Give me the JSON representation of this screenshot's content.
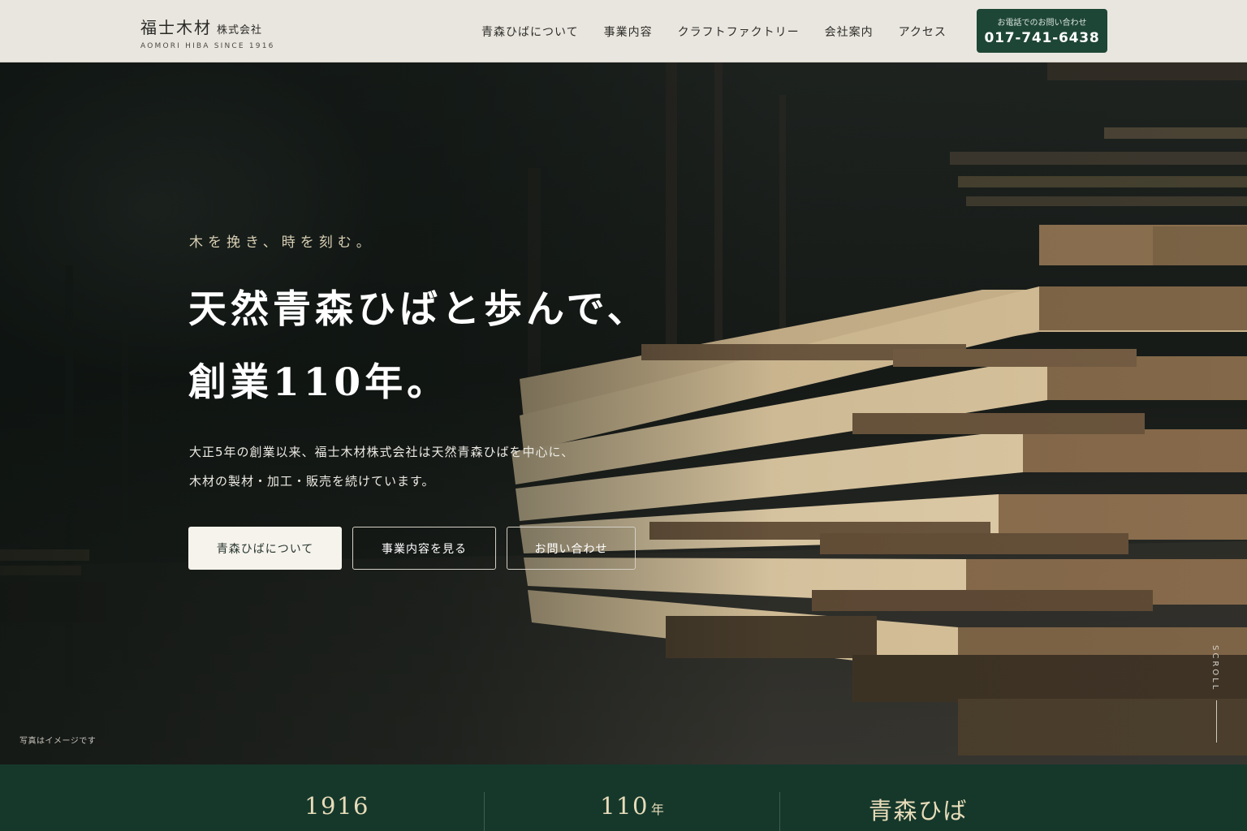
{
  "header": {
    "brand_name": "福士木材",
    "brand_suffix": "株式会社",
    "brand_sub": "AOMORI HIBA SINCE 1916",
    "nav": [
      {
        "label": "青森ひばについて"
      },
      {
        "label": "事業内容"
      },
      {
        "label": "クラフトファクトリー"
      },
      {
        "label": "会社案内"
      },
      {
        "label": "アクセス"
      }
    ],
    "phone_label": "お電話でのお問い合わせ",
    "phone_number": "017-741-6438"
  },
  "hero": {
    "tagline": "木を挽き、時を刻む。",
    "headline_line1": "天然青森ひばと歩んで、",
    "headline_line2": "創業110年。",
    "description_line1": "大正5年の創業以来、福士木材株式会社は天然青森ひばを中心に、",
    "description_line2": "木材の製材・加工・販売を続けています。",
    "cta_primary": "青森ひばについて",
    "cta_secondary": "事業内容を見る",
    "cta_contact": "お問い合わせ",
    "photo_note": "写真はイメージです",
    "scroll_label": "SCROLL"
  },
  "stats": [
    {
      "value": "1916",
      "unit": ""
    },
    {
      "value": "110",
      "unit": "年"
    },
    {
      "value": "青森ひば",
      "unit": ""
    }
  ],
  "colors": {
    "header_bg": "#e9e6df",
    "accent_green": "#1e4636",
    "stats_bg": "#16382b",
    "stats_text": "#e7dcb9",
    "tagline": "#d8cfb4"
  }
}
